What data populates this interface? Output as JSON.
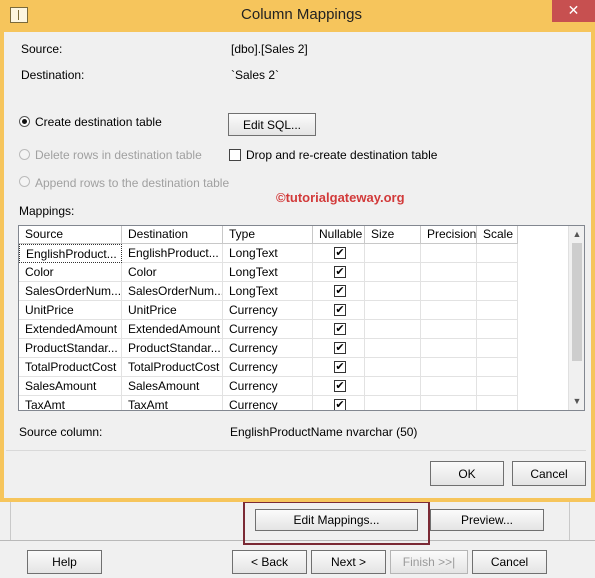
{
  "dialog": {
    "title": "Column Mappings",
    "close_glyph": "✕",
    "source_label": "Source:",
    "source_value": "[dbo].[Sales 2]",
    "destination_label": "Destination:",
    "destination_value": "`Sales 2`",
    "options": {
      "create_table": "Create destination table",
      "delete_rows": "Delete rows in destination table",
      "append_rows": "Append rows to the destination table",
      "drop_recreate": "Drop and re-create destination table"
    },
    "edit_sql_label": "Edit SQL...",
    "watermark": "©tutorialgateway.org",
    "mappings_label": "Mappings:",
    "columns": [
      "Source",
      "Destination",
      "Type",
      "Nullable",
      "Size",
      "Precision",
      "Scale"
    ],
    "rows": [
      {
        "source": "EnglishProduct...",
        "destination": "EnglishProduct...",
        "type": "LongText",
        "nullable": "✔"
      },
      {
        "source": "Color",
        "destination": "Color",
        "type": "LongText",
        "nullable": "✔"
      },
      {
        "source": "SalesOrderNum...",
        "destination": "SalesOrderNum...",
        "type": "LongText",
        "nullable": "✔"
      },
      {
        "source": "UnitPrice",
        "destination": "UnitPrice",
        "type": "Currency",
        "nullable": "✔"
      },
      {
        "source": "ExtendedAmount",
        "destination": "ExtendedAmount",
        "type": "Currency",
        "nullable": "✔"
      },
      {
        "source": "ProductStandar...",
        "destination": "ProductStandar...",
        "type": "Currency",
        "nullable": "✔"
      },
      {
        "source": "TotalProductCost",
        "destination": "TotalProductCost",
        "type": "Currency",
        "nullable": "✔"
      },
      {
        "source": "SalesAmount",
        "destination": "SalesAmount",
        "type": "Currency",
        "nullable": "✔"
      },
      {
        "source": "TaxAmt",
        "destination": "TaxAmt",
        "type": "Currency",
        "nullable": "✔"
      }
    ],
    "source_column_label": "Source column:",
    "source_column_value": "EnglishProductName nvarchar (50)",
    "ok_label": "OK",
    "cancel_label": "Cancel"
  },
  "wizard": {
    "edit_mappings_label": "Edit Mappings...",
    "preview_label": "Preview...",
    "help_label": "Help",
    "back_label": "< Back",
    "next_label": "Next >",
    "finish_label": "Finish >>|",
    "cancel_label": "Cancel"
  },
  "colors": {
    "title_bar": "#f6c55c",
    "close_button": "#c75050",
    "highlight_box": "#7b2a35",
    "watermark": "#d23a3a"
  }
}
